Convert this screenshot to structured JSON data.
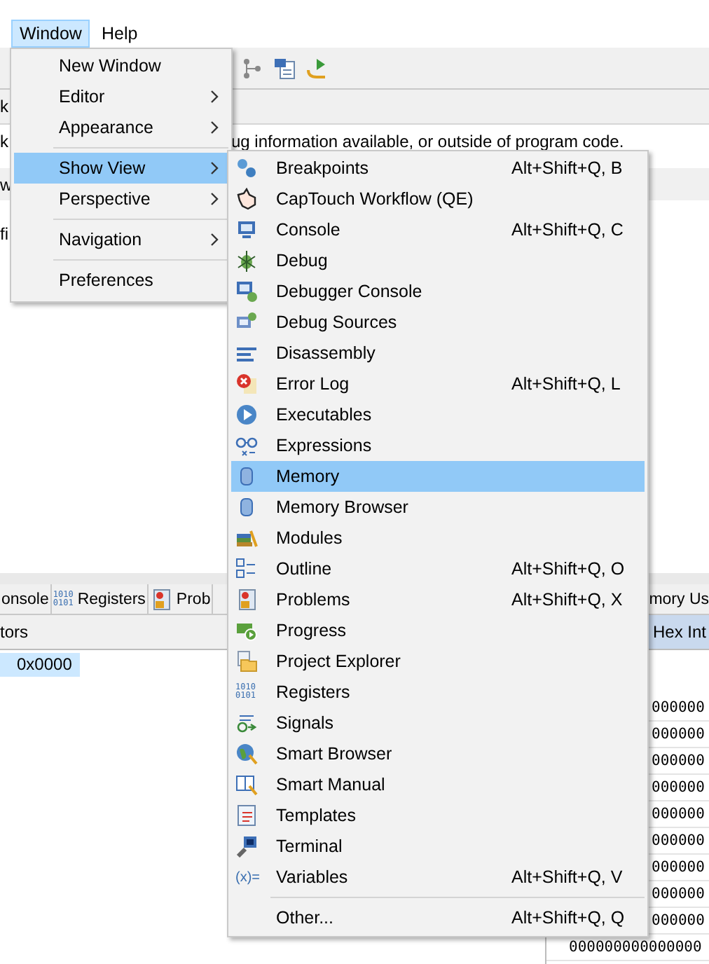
{
  "menu_bar": [
    {
      "label": "Window",
      "selected": true
    },
    {
      "label": "Help",
      "selected": false
    }
  ],
  "editor": {
    "tab_fragment": "k",
    "message_left": "k",
    "message_right": "ug information available, or outside of program code.",
    "row_fragment": "w",
    "line_fragment": "fi"
  },
  "bottom_panel": {
    "tabs": [
      {
        "label": "onsole"
      },
      {
        "label": "Registers",
        "icon_text": "1010\n0101"
      },
      {
        "label": "Prob"
      }
    ],
    "right_tab": "mory Us",
    "column_header": "tors",
    "right_header": "Hex Int",
    "rows": [
      {
        "label": "0x0000",
        "selected": true
      }
    ],
    "hex_values": [
      "000000",
      "000000",
      "000000",
      "000000",
      "000000",
      "000000",
      "000000",
      "000000",
      "000000",
      "000000000000000"
    ]
  },
  "window_menu": {
    "items": [
      {
        "kind": "item",
        "label": "New Window",
        "has_submenu": false,
        "selected": false
      },
      {
        "kind": "item",
        "label": "Editor",
        "has_submenu": true,
        "selected": false
      },
      {
        "kind": "item",
        "label": "Appearance",
        "has_submenu": true,
        "selected": false
      },
      {
        "kind": "separator"
      },
      {
        "kind": "item",
        "label": "Show View",
        "has_submenu": true,
        "selected": true
      },
      {
        "kind": "item",
        "label": "Perspective",
        "has_submenu": true,
        "selected": false
      },
      {
        "kind": "separator"
      },
      {
        "kind": "item",
        "label": "Navigation",
        "has_submenu": true,
        "selected": false
      },
      {
        "kind": "separator"
      },
      {
        "kind": "item",
        "label": "Preferences",
        "has_submenu": false,
        "selected": false
      }
    ]
  },
  "show_view_menu": {
    "items": [
      {
        "kind": "item",
        "label": "Breakpoints",
        "shortcut": "Alt+Shift+Q, B",
        "selected": false
      },
      {
        "kind": "item",
        "label": "CapTouch Workflow (QE)",
        "selected": false
      },
      {
        "kind": "item",
        "label": "Console",
        "shortcut": "Alt+Shift+Q, C",
        "selected": false
      },
      {
        "kind": "item",
        "label": "Debug",
        "selected": false
      },
      {
        "kind": "item",
        "label": "Debugger Console",
        "selected": false
      },
      {
        "kind": "item",
        "label": "Debug Sources",
        "selected": false
      },
      {
        "kind": "item",
        "label": "Disassembly",
        "selected": false
      },
      {
        "kind": "item",
        "label": "Error Log",
        "shortcut": "Alt+Shift+Q, L",
        "selected": false
      },
      {
        "kind": "item",
        "label": "Executables",
        "selected": false
      },
      {
        "kind": "item",
        "label": "Expressions",
        "selected": false
      },
      {
        "kind": "item",
        "label": "Memory",
        "selected": true
      },
      {
        "kind": "item",
        "label": "Memory Browser",
        "selected": false
      },
      {
        "kind": "item",
        "label": "Modules",
        "selected": false
      },
      {
        "kind": "item",
        "label": "Outline",
        "shortcut": "Alt+Shift+Q, O",
        "selected": false
      },
      {
        "kind": "item",
        "label": "Problems",
        "shortcut": "Alt+Shift+Q, X",
        "selected": false
      },
      {
        "kind": "item",
        "label": "Progress",
        "selected": false
      },
      {
        "kind": "item",
        "label": "Project Explorer",
        "selected": false
      },
      {
        "kind": "item",
        "label": "Registers",
        "icon_text": "1010\n0101",
        "selected": false
      },
      {
        "kind": "item",
        "label": "Signals",
        "selected": false
      },
      {
        "kind": "item",
        "label": "Smart Browser",
        "selected": false
      },
      {
        "kind": "item",
        "label": "Smart Manual",
        "selected": false
      },
      {
        "kind": "item",
        "label": "Templates",
        "selected": false
      },
      {
        "kind": "item",
        "label": "Terminal",
        "selected": false
      },
      {
        "kind": "item",
        "label": "Variables",
        "icon_text": "(x)=",
        "shortcut": "Alt+Shift+Q, V",
        "selected": false
      },
      {
        "kind": "separator"
      },
      {
        "kind": "item",
        "label": "Other...",
        "shortcut": "Alt+Shift+Q, Q",
        "selected": false
      }
    ]
  }
}
